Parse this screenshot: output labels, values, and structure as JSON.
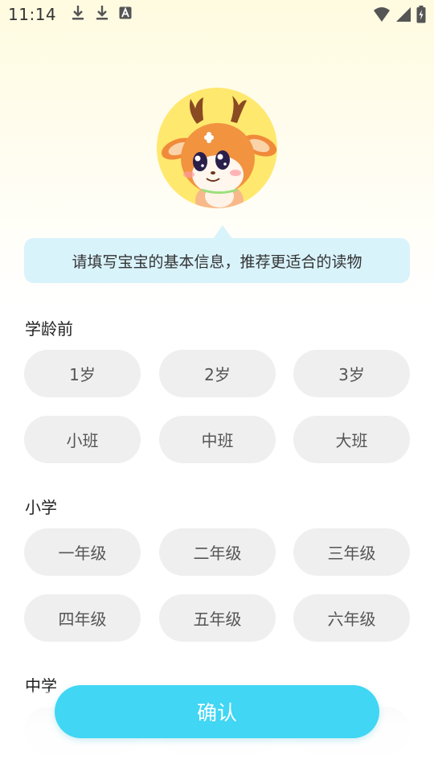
{
  "status_bar": {
    "time": "11:14",
    "left_icons": [
      "download-icon",
      "download-icon",
      "font-a-icon"
    ],
    "right_icons": [
      "wifi-icon",
      "cellular-signal-icon",
      "battery-charging-icon"
    ]
  },
  "bubble": {
    "text": "请填写宝宝的基本信息，推荐更适合的读物"
  },
  "sections": [
    {
      "title": "学龄前",
      "options": [
        "1岁",
        "2岁",
        "3岁",
        "小班",
        "中班",
        "大班"
      ]
    },
    {
      "title": "小学",
      "options": [
        "一年级",
        "二年级",
        "三年级",
        "四年级",
        "五年级",
        "六年级"
      ]
    },
    {
      "title": "中学"
    }
  ],
  "confirm_label": "确认",
  "colors": {
    "accent": "#40d6f4",
    "chip_bg": "#efefef",
    "bubble_bg": "#d9f3fb",
    "avatar_bg": "#ffe86e"
  }
}
